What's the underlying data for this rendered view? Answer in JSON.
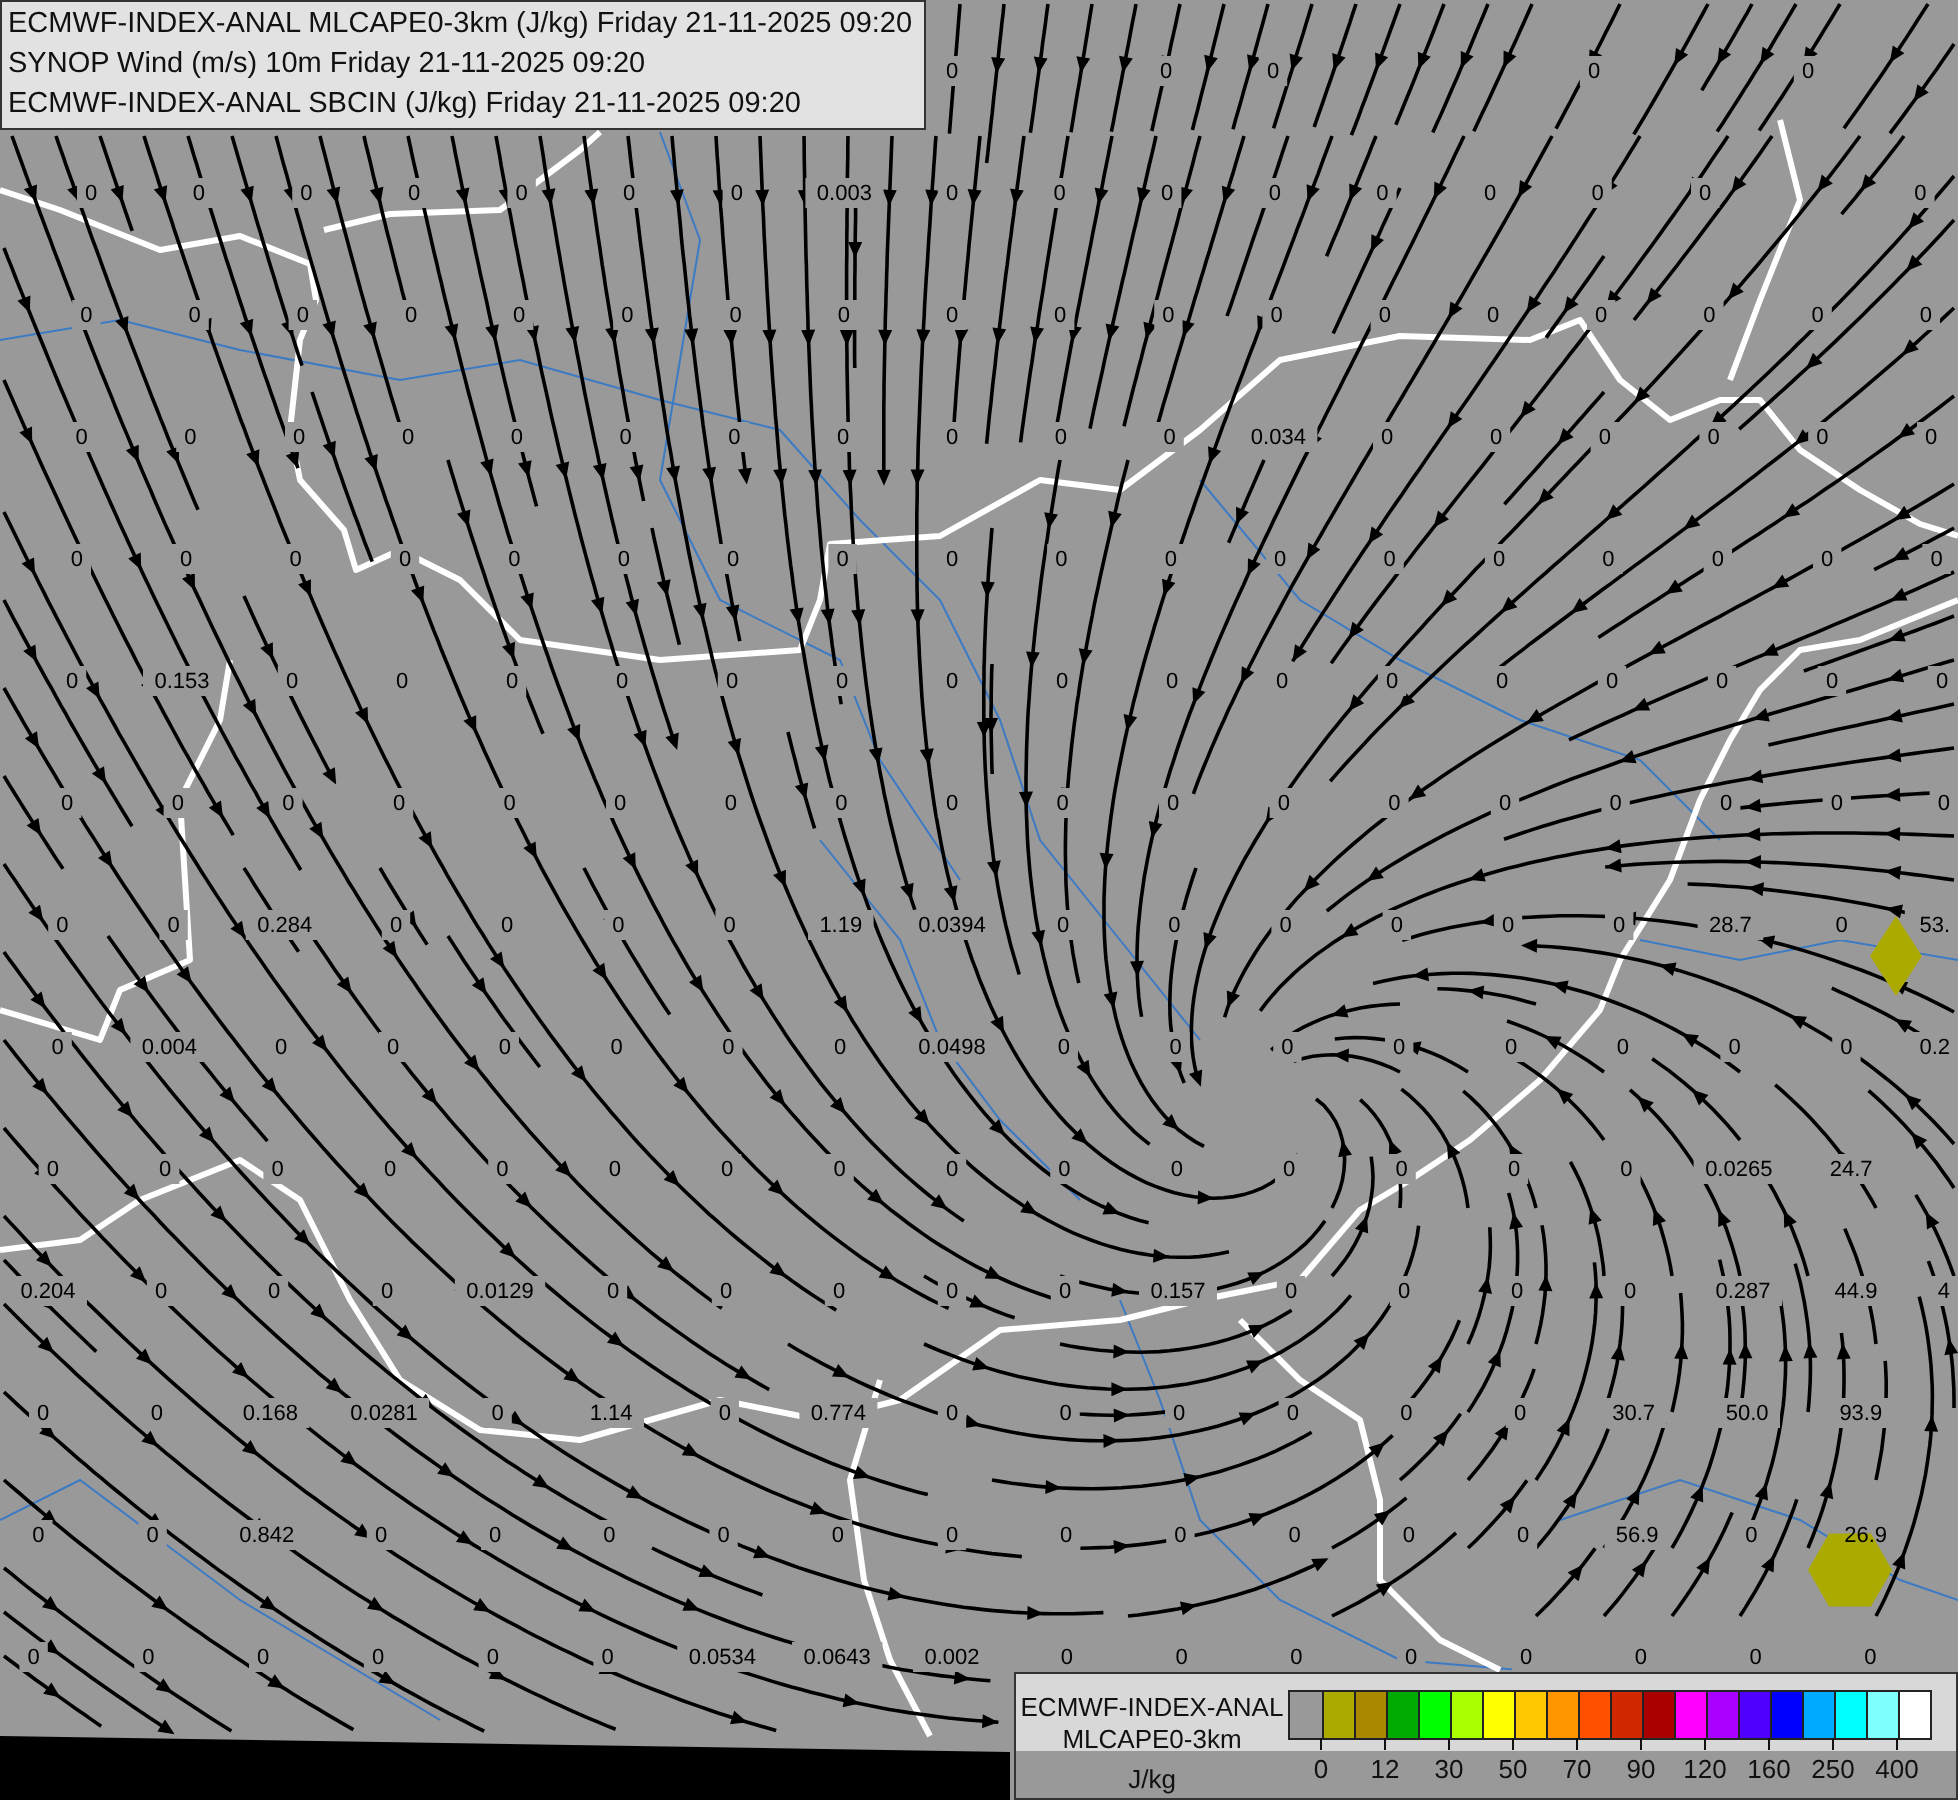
{
  "header": {
    "lines": [
      "ECMWF-INDEX-ANAL MLCAPE0-3km (J/kg) Friday 21-11-2025 09:20",
      "SYNOP Wind (m/s) 10m Friday 21-11-2025 09:20",
      "ECMWF-INDEX-ANAL SBCIN (J/kg) Friday 21-11-2025 09:20"
    ]
  },
  "map": {
    "cape_grid": [
      [
        {
          "kind": "gap"
        },
        {
          "kind": "gap"
        },
        {
          "kind": "gap"
        },
        {
          "kind": "gap"
        },
        {
          "kind": "gap"
        },
        {
          "kind": "gap"
        },
        {
          "kind": "gap"
        },
        {
          "kind": "gap"
        },
        {
          "kind": "value",
          "text": "0"
        },
        {
          "kind": "gap"
        },
        {
          "kind": "value",
          "text": "0"
        },
        {
          "kind": "value",
          "text": "0"
        },
        {
          "kind": "gap"
        },
        {
          "kind": "gap"
        },
        {
          "kind": "value",
          "text": "0"
        },
        {
          "kind": "gap"
        },
        {
          "kind": "value",
          "text": "0"
        }
      ],
      [
        {
          "kind": "value",
          "text": "0"
        },
        {
          "kind": "value",
          "text": "0"
        },
        {
          "kind": "value",
          "text": "0"
        },
        {
          "kind": "value",
          "text": "0"
        },
        {
          "kind": "value",
          "text": "0"
        },
        {
          "kind": "value",
          "text": "0"
        },
        {
          "kind": "value",
          "text": "0"
        },
        {
          "kind": "value",
          "text": "0.003"
        },
        {
          "kind": "value",
          "text": "0"
        },
        {
          "kind": "value",
          "text": "0"
        },
        {
          "kind": "value",
          "text": "0"
        },
        {
          "kind": "value",
          "text": "0"
        },
        {
          "kind": "value",
          "text": "0"
        },
        {
          "kind": "value",
          "text": "0"
        },
        {
          "kind": "value",
          "text": "0"
        },
        {
          "kind": "value",
          "text": "0"
        },
        {
          "kind": "gap"
        },
        {
          "kind": "value",
          "text": "0"
        }
      ],
      [
        {
          "kind": "value",
          "text": "0"
        },
        {
          "kind": "value",
          "text": "0"
        },
        {
          "kind": "value",
          "text": "0"
        },
        {
          "kind": "value",
          "text": "0"
        },
        {
          "kind": "value",
          "text": "0"
        },
        {
          "kind": "value",
          "text": "0"
        },
        {
          "kind": "value",
          "text": "0"
        },
        {
          "kind": "value",
          "text": "0"
        },
        {
          "kind": "value",
          "text": "0"
        },
        {
          "kind": "value",
          "text": "0"
        },
        {
          "kind": "value",
          "text": "0"
        },
        {
          "kind": "value",
          "text": "0"
        },
        {
          "kind": "value",
          "text": "0"
        },
        {
          "kind": "value",
          "text": "0"
        },
        {
          "kind": "value",
          "text": "0"
        },
        {
          "kind": "value",
          "text": "0"
        },
        {
          "kind": "value",
          "text": "0"
        },
        {
          "kind": "value",
          "text": "0"
        }
      ],
      [
        {
          "kind": "value",
          "text": "0"
        },
        {
          "kind": "value",
          "text": "0"
        },
        {
          "kind": "value",
          "text": "0"
        },
        {
          "kind": "value",
          "text": "0"
        },
        {
          "kind": "value",
          "text": "0"
        },
        {
          "kind": "value",
          "text": "0"
        },
        {
          "kind": "value",
          "text": "0"
        },
        {
          "kind": "value",
          "text": "0"
        },
        {
          "kind": "value",
          "text": "0"
        },
        {
          "kind": "value",
          "text": "0"
        },
        {
          "kind": "value",
          "text": "0"
        },
        {
          "kind": "value",
          "text": "0.034"
        },
        {
          "kind": "value",
          "text": "0"
        },
        {
          "kind": "value",
          "text": "0"
        },
        {
          "kind": "value",
          "text": "0"
        },
        {
          "kind": "value",
          "text": "0"
        },
        {
          "kind": "value",
          "text": "0"
        },
        {
          "kind": "value",
          "text": "0"
        }
      ],
      [
        {
          "kind": "value",
          "text": "0"
        },
        {
          "kind": "value",
          "text": "0"
        },
        {
          "kind": "value",
          "text": "0"
        },
        {
          "kind": "value",
          "text": "0"
        },
        {
          "kind": "value",
          "text": "0"
        },
        {
          "kind": "value",
          "text": "0"
        },
        {
          "kind": "value",
          "text": "0"
        },
        {
          "kind": "value",
          "text": "0"
        },
        {
          "kind": "value",
          "text": "0"
        },
        {
          "kind": "value",
          "text": "0"
        },
        {
          "kind": "value",
          "text": "0"
        },
        {
          "kind": "value",
          "text": "0"
        },
        {
          "kind": "value",
          "text": "0"
        },
        {
          "kind": "value",
          "text": "0"
        },
        {
          "kind": "value",
          "text": "0"
        },
        {
          "kind": "value",
          "text": "0"
        },
        {
          "kind": "value",
          "text": "0"
        },
        {
          "kind": "value",
          "text": "0"
        }
      ],
      [
        {
          "kind": "value",
          "text": "0"
        },
        {
          "kind": "value",
          "text": "0.153"
        },
        {
          "kind": "value",
          "text": "0"
        },
        {
          "kind": "value",
          "text": "0"
        },
        {
          "kind": "value",
          "text": "0"
        },
        {
          "kind": "value",
          "text": "0"
        },
        {
          "kind": "value",
          "text": "0"
        },
        {
          "kind": "value",
          "text": "0"
        },
        {
          "kind": "value",
          "text": "0"
        },
        {
          "kind": "value",
          "text": "0"
        },
        {
          "kind": "value",
          "text": "0"
        },
        {
          "kind": "value",
          "text": "0"
        },
        {
          "kind": "value",
          "text": "0"
        },
        {
          "kind": "value",
          "text": "0"
        },
        {
          "kind": "value",
          "text": "0"
        },
        {
          "kind": "value",
          "text": "0"
        },
        {
          "kind": "value",
          "text": "0"
        },
        {
          "kind": "value",
          "text": "0"
        }
      ],
      [
        {
          "kind": "value",
          "text": "0"
        },
        {
          "kind": "value",
          "text": "0"
        },
        {
          "kind": "value",
          "text": "0"
        },
        {
          "kind": "value",
          "text": "0"
        },
        {
          "kind": "value",
          "text": "0"
        },
        {
          "kind": "value",
          "text": "0"
        },
        {
          "kind": "value",
          "text": "0"
        },
        {
          "kind": "value",
          "text": "0"
        },
        {
          "kind": "value",
          "text": "0"
        },
        {
          "kind": "value",
          "text": "0"
        },
        {
          "kind": "value",
          "text": "0"
        },
        {
          "kind": "value",
          "text": "0"
        },
        {
          "kind": "value",
          "text": "0"
        },
        {
          "kind": "value",
          "text": "0"
        },
        {
          "kind": "value",
          "text": "0"
        },
        {
          "kind": "value",
          "text": "0"
        },
        {
          "kind": "value",
          "text": "0"
        },
        {
          "kind": "value",
          "text": "0"
        }
      ],
      [
        {
          "kind": "value",
          "text": "0"
        },
        {
          "kind": "value",
          "text": "0"
        },
        {
          "kind": "value",
          "text": "0.284"
        },
        {
          "kind": "value",
          "text": "0"
        },
        {
          "kind": "value",
          "text": "0"
        },
        {
          "kind": "value",
          "text": "0"
        },
        {
          "kind": "value",
          "text": "0"
        },
        {
          "kind": "value",
          "text": "1.19"
        },
        {
          "kind": "value",
          "text": "0.0394"
        },
        {
          "kind": "value",
          "text": "0"
        },
        {
          "kind": "value",
          "text": "0"
        },
        {
          "kind": "value",
          "text": "0"
        },
        {
          "kind": "value",
          "text": "0"
        },
        {
          "kind": "value",
          "text": "0"
        },
        {
          "kind": "value",
          "text": "0"
        },
        {
          "kind": "value",
          "text": "28.7"
        },
        {
          "kind": "value",
          "text": "0"
        },
        {
          "kind": "value",
          "text": "53."
        }
      ],
      [
        {
          "kind": "value",
          "text": "0"
        },
        {
          "kind": "value",
          "text": "0.004"
        },
        {
          "kind": "value",
          "text": "0"
        },
        {
          "kind": "value",
          "text": "0"
        },
        {
          "kind": "value",
          "text": "0"
        },
        {
          "kind": "value",
          "text": "0"
        },
        {
          "kind": "value",
          "text": "0"
        },
        {
          "kind": "value",
          "text": "0"
        },
        {
          "kind": "value",
          "text": "0.0498"
        },
        {
          "kind": "value",
          "text": "0"
        },
        {
          "kind": "value",
          "text": "0"
        },
        {
          "kind": "value",
          "text": "0"
        },
        {
          "kind": "value",
          "text": "0"
        },
        {
          "kind": "value",
          "text": "0"
        },
        {
          "kind": "value",
          "text": "0"
        },
        {
          "kind": "value",
          "text": "0"
        },
        {
          "kind": "value",
          "text": "0"
        },
        {
          "kind": "value",
          "text": "0.2"
        }
      ],
      [
        {
          "kind": "value",
          "text": "0"
        },
        {
          "kind": "value",
          "text": "0"
        },
        {
          "kind": "value",
          "text": "0"
        },
        {
          "kind": "value",
          "text": "0"
        },
        {
          "kind": "value",
          "text": "0"
        },
        {
          "kind": "value",
          "text": "0"
        },
        {
          "kind": "value",
          "text": "0"
        },
        {
          "kind": "value",
          "text": "0"
        },
        {
          "kind": "value",
          "text": "0"
        },
        {
          "kind": "value",
          "text": "0"
        },
        {
          "kind": "value",
          "text": "0"
        },
        {
          "kind": "value",
          "text": "0"
        },
        {
          "kind": "value",
          "text": "0"
        },
        {
          "kind": "value",
          "text": "0"
        },
        {
          "kind": "value",
          "text": "0"
        },
        {
          "kind": "value",
          "text": "0.0265"
        },
        {
          "kind": "value",
          "text": "24.7"
        }
      ],
      [
        {
          "kind": "value",
          "text": "0.204"
        },
        {
          "kind": "value",
          "text": "0"
        },
        {
          "kind": "value",
          "text": "0"
        },
        {
          "kind": "value",
          "text": "0"
        },
        {
          "kind": "value",
          "text": "0.0129"
        },
        {
          "kind": "value",
          "text": "0"
        },
        {
          "kind": "value",
          "text": "0"
        },
        {
          "kind": "value",
          "text": "0"
        },
        {
          "kind": "value",
          "text": "0"
        },
        {
          "kind": "value",
          "text": "0"
        },
        {
          "kind": "value",
          "text": "0.157"
        },
        {
          "kind": "value",
          "text": "0"
        },
        {
          "kind": "value",
          "text": "0"
        },
        {
          "kind": "value",
          "text": "0"
        },
        {
          "kind": "value",
          "text": "0"
        },
        {
          "kind": "value",
          "text": "0.287"
        },
        {
          "kind": "value",
          "text": "44.9"
        },
        {
          "kind": "value",
          "text": "4"
        }
      ],
      [
        {
          "kind": "value",
          "text": "0"
        },
        {
          "kind": "value",
          "text": "0"
        },
        {
          "kind": "value",
          "text": "0.168"
        },
        {
          "kind": "value",
          "text": "0.0281"
        },
        {
          "kind": "value",
          "text": "0"
        },
        {
          "kind": "value",
          "text": "1.14"
        },
        {
          "kind": "value",
          "text": "0"
        },
        {
          "kind": "value",
          "text": "0.774"
        },
        {
          "kind": "value",
          "text": "0"
        },
        {
          "kind": "value",
          "text": "0"
        },
        {
          "kind": "value",
          "text": "0"
        },
        {
          "kind": "value",
          "text": "0"
        },
        {
          "kind": "value",
          "text": "0"
        },
        {
          "kind": "value",
          "text": "0"
        },
        {
          "kind": "value",
          "text": "30.7"
        },
        {
          "kind": "value",
          "text": "50.0"
        },
        {
          "kind": "value",
          "text": "93.9"
        }
      ],
      [
        {
          "kind": "value",
          "text": "0"
        },
        {
          "kind": "value",
          "text": "0"
        },
        {
          "kind": "value",
          "text": "0.842"
        },
        {
          "kind": "value",
          "text": "0"
        },
        {
          "kind": "value",
          "text": "0"
        },
        {
          "kind": "value",
          "text": "0"
        },
        {
          "kind": "value",
          "text": "0"
        },
        {
          "kind": "value",
          "text": "0"
        },
        {
          "kind": "value",
          "text": "0"
        },
        {
          "kind": "value",
          "text": "0"
        },
        {
          "kind": "value",
          "text": "0"
        },
        {
          "kind": "value",
          "text": "0"
        },
        {
          "kind": "value",
          "text": "0"
        },
        {
          "kind": "value",
          "text": "0"
        },
        {
          "kind": "value",
          "text": "56.9"
        },
        {
          "kind": "value",
          "text": "0"
        },
        {
          "kind": "value",
          "text": "26.9"
        }
      ],
      [
        {
          "kind": "value",
          "text": "0"
        },
        {
          "kind": "value",
          "text": "0"
        },
        {
          "kind": "value",
          "text": "0"
        },
        {
          "kind": "value",
          "text": "0"
        },
        {
          "kind": "value",
          "text": "0"
        },
        {
          "kind": "value",
          "text": "0"
        },
        {
          "kind": "value",
          "text": "0.0534"
        },
        {
          "kind": "value",
          "text": "0.0643"
        },
        {
          "kind": "value",
          "text": "0.002"
        },
        {
          "kind": "value",
          "text": "0"
        },
        {
          "kind": "value",
          "text": "0"
        },
        {
          "kind": "value",
          "text": "0"
        },
        {
          "kind": "value",
          "text": "0"
        },
        {
          "kind": "value",
          "text": "0"
        },
        {
          "kind": "value",
          "text": "0"
        },
        {
          "kind": "value",
          "text": "0"
        },
        {
          "kind": "value",
          "text": "0"
        }
      ]
    ]
  },
  "legend": {
    "title_lines": [
      "ECMWF-INDEX-ANAL",
      "MLCAPE0-3km"
    ],
    "unit": "J/kg",
    "bins": [
      {
        "color": "#999999"
      },
      {
        "color": "#aaaa00"
      },
      {
        "color": "#aa8800"
      },
      {
        "color": "#00aa00"
      },
      {
        "color": "#00ff00"
      },
      {
        "color": "#aaff00"
      },
      {
        "color": "#ffff00"
      },
      {
        "color": "#ffc800"
      },
      {
        "color": "#ff9600"
      },
      {
        "color": "#ff5000"
      },
      {
        "color": "#d22800"
      },
      {
        "color": "#aa0000"
      },
      {
        "color": "#ff00ff"
      },
      {
        "color": "#aa00ff"
      },
      {
        "color": "#5000ff"
      },
      {
        "color": "#0000ff"
      },
      {
        "color": "#00aaff"
      },
      {
        "color": "#00ffff"
      },
      {
        "color": "#80ffff"
      },
      {
        "color": "#ffffff"
      }
    ],
    "ticks": [
      "0",
      "12",
      "30",
      "50",
      "70",
      "90",
      "120",
      "160",
      "250",
      "400"
    ]
  }
}
